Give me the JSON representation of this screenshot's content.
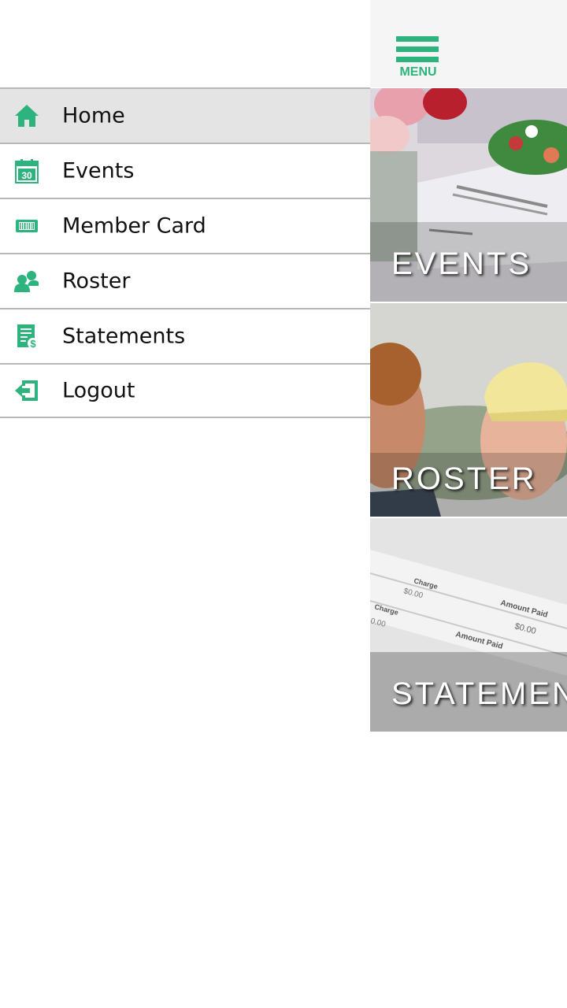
{
  "drawer": {
    "items": [
      {
        "label": "Home",
        "icon": "home-icon",
        "active": true
      },
      {
        "label": "Events",
        "icon": "calendar-icon",
        "calendar_day": "30"
      },
      {
        "label": "Member Card",
        "icon": "barcode-card-icon"
      },
      {
        "label": "Roster",
        "icon": "person-icon"
      },
      {
        "label": "Statements",
        "icon": "statement-icon"
      },
      {
        "label": "Logout",
        "icon": "logout-icon"
      }
    ]
  },
  "main": {
    "menu_button_label": "MENU",
    "tiles": [
      {
        "label": "EVENTS"
      },
      {
        "label": "ROSTER"
      },
      {
        "label": "STATEMEN"
      }
    ],
    "statement_image_text": {
      "charge_1": "Charge",
      "amount_1": "$0.00",
      "amount_paid_1": "Amount Paid",
      "paid_value_1": "$0.00",
      "charge_2": "Charge",
      "amount_2": "0.00",
      "amount_paid_2": "Amount Paid"
    }
  },
  "colors": {
    "accent": "#2db37d",
    "active_row": "#e4e4e4",
    "divider": "#b8b8b8",
    "topbar": "#f5f5f5"
  }
}
